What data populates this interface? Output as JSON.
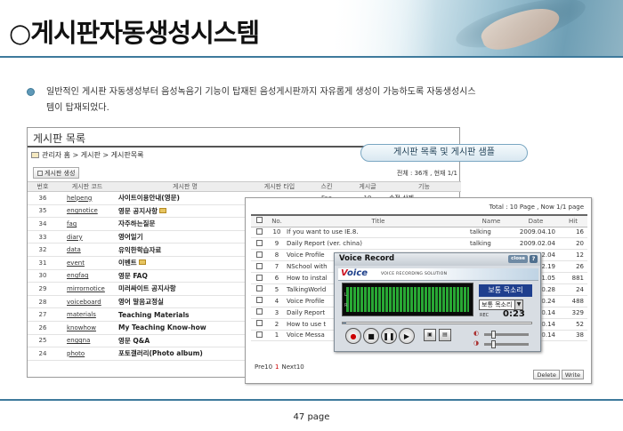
{
  "slide": {
    "title": "○게시판자동생성시스템",
    "bullet_line1": "일반적인 게시판 자동생성부터 음성녹음기 기능이 탑재된 음성게시판까지 자유롭게 생성이 가능하도록 자동생성시스",
    "bullet_line2": "템이 탑재되었다.",
    "page": "47 page",
    "accent": "#3e7a9c"
  },
  "board": {
    "title": "게시판 목록",
    "breadcrumb": "관리자 홈 > 게시판 > 게시판목록",
    "create_button": "게시판 생성",
    "total": "전체 : 36개 , 현재 1/1",
    "columns": [
      "번호",
      "게시판 코드",
      "게시판 명",
      "게시판 타입",
      "스킨",
      "게시글",
      "기능"
    ],
    "rows": [
      {
        "no": "36",
        "code": "helpeng",
        "name": "사이트이용안내(영문)",
        "type": "",
        "skin": "Fao",
        "count": "19",
        "action": "수정 삭제"
      },
      {
        "no": "35",
        "code": "engnotice",
        "name": "영문 공지사항",
        "type": "",
        "skin": "",
        "count": "",
        "action": ""
      },
      {
        "no": "34",
        "code": "faq",
        "name": "자주하는질문",
        "type": "",
        "skin": "",
        "count": "",
        "action": ""
      },
      {
        "no": "33",
        "code": "diary",
        "name": "영어일기",
        "type": "",
        "skin": "",
        "count": "",
        "action": ""
      },
      {
        "no": "32",
        "code": "data",
        "name": "유익한학습자료",
        "type": "",
        "skin": "",
        "count": "",
        "action": ""
      },
      {
        "no": "31",
        "code": "event",
        "name": "이벤트",
        "type": "",
        "skin": "",
        "count": "",
        "action": ""
      },
      {
        "no": "30",
        "code": "engfaq",
        "name": "영문 FAQ",
        "type": "",
        "skin": "",
        "count": "",
        "action": ""
      },
      {
        "no": "29",
        "code": "mirrornotice",
        "name": "미러싸이트 공지사항",
        "type": "",
        "skin": "",
        "count": "",
        "action": ""
      },
      {
        "no": "28",
        "code": "voiceboard",
        "name": "영어 말음교정실",
        "type": "",
        "skin": "",
        "count": "",
        "action": ""
      },
      {
        "no": "27",
        "code": "materials",
        "name": "Teaching Materials",
        "type": "",
        "skin": "",
        "count": "",
        "action": ""
      },
      {
        "no": "26",
        "code": "knowhow",
        "name": "My Teaching Know-how",
        "type": "",
        "skin": "",
        "count": "",
        "action": ""
      },
      {
        "no": "25",
        "code": "engqna",
        "name": "영문 Q&A",
        "type": "",
        "skin": "",
        "count": "",
        "action": ""
      },
      {
        "no": "24",
        "code": "photo",
        "name": "포토갤러리(Photo album)",
        "type": "",
        "skin": "",
        "count": "",
        "action": ""
      }
    ]
  },
  "sample_badge": "게시판 목록 및 게시판 샘플",
  "list": {
    "total": "Total : 10 Page ,  Now 1/1 page",
    "columns": [
      "No.",
      "Title",
      "Name",
      "Date",
      "Hit"
    ],
    "rows": [
      {
        "no": "10",
        "title": "If you want to use IE.8.",
        "name": "talking",
        "date": "2009.04.10",
        "hit": "16"
      },
      {
        "no": "9",
        "title": "Daily Report (ver. china)",
        "name": "talking",
        "date": "2009.02.04",
        "hit": "20"
      },
      {
        "no": "8",
        "title": "Voice Profile",
        "name": "",
        "date": "2.04",
        "hit": "12"
      },
      {
        "no": "7",
        "title": "NSchool with",
        "name": "",
        "date": "2.19",
        "hit": "26"
      },
      {
        "no": "6",
        "title": "How to instal",
        "name": "",
        "date": "1.05",
        "hit": "881"
      },
      {
        "no": "5",
        "title": "TalkingWorld",
        "name": "",
        "date": "0.28",
        "hit": "24"
      },
      {
        "no": "4",
        "title": "Voice Profile",
        "name": "",
        "date": "0.24",
        "hit": "488"
      },
      {
        "no": "3",
        "title": "Daily Report",
        "name": "",
        "date": "0.14",
        "hit": "329"
      },
      {
        "no": "2",
        "title": "How to use t",
        "name": "",
        "date": "0.14",
        "hit": "52"
      },
      {
        "no": "1",
        "title": "Voice Messa",
        "name": "",
        "date": "0.14",
        "hit": "38"
      }
    ],
    "prev": "Pre10",
    "page": "1",
    "next": "Next10",
    "delete": "Delete",
    "write": "Write"
  },
  "voice": {
    "title": "Voice Record",
    "close": "close",
    "help": "?",
    "logo_v": "V",
    "logo_rest": "oice",
    "subtitle": "VOICE RECORDING SOLUTION",
    "quality_tag": "보통 목소리",
    "quality_select": "보통 목소리",
    "rec_label": "REC",
    "time": "0:23",
    "meter_l": "L",
    "meter_r": "R",
    "progress": 0.02
  }
}
